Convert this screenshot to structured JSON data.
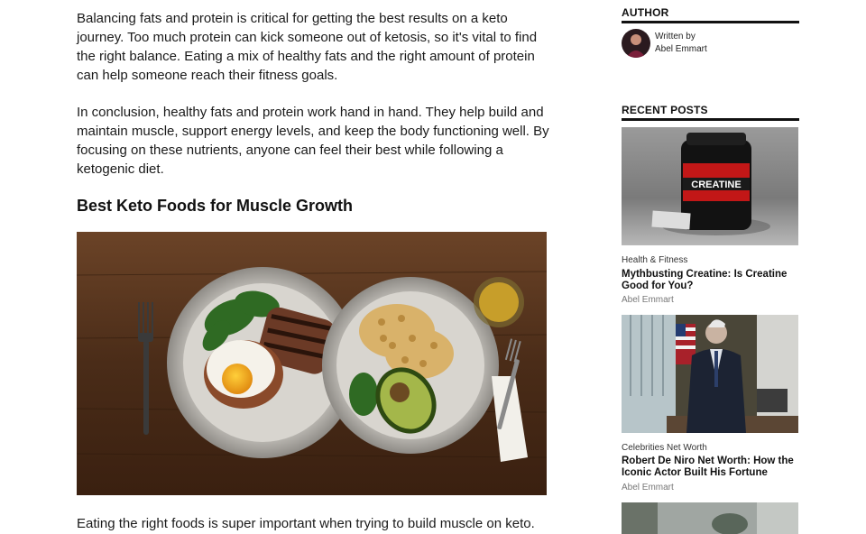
{
  "article": {
    "paragraphs": [
      "Balancing fats and protein is critical for getting the best results on a keto journey. Too much protein can kick someone out of ketosis, so it's vital to find the right balance. Eating a mix of healthy fats and the right amount of protein can help someone reach their fitness goals.",
      "In conclusion, healthy fats and protein work hand in hand. They help build and maintain muscle, support energy levels, and keep the body functioning well. By focusing on these nutrients, anyone can feel their best while following a ketogenic diet.",
      "Eating the right foods is super important when trying to build muscle on keto. The"
    ],
    "section_heading": "Best Keto Foods for Muscle Growth"
  },
  "sidebar": {
    "author_widget": {
      "title": "AUTHOR",
      "written_by": "Written by",
      "author_name": "Abel Emmart"
    },
    "recent_posts": {
      "title": "RECENT POSTS",
      "posts": [
        {
          "category": "Health & Fitness",
          "title": "Mythbusting Creatine: Is Creatine Good for You?",
          "author": "Abel Emmart",
          "thumb_label": "CREATINE"
        },
        {
          "category": "Celebrities Net Worth",
          "title": "Robert De Niro Net Worth: How the Iconic Actor Built His Fortune",
          "author": "Abel Emmart"
        }
      ]
    }
  },
  "colors": {
    "text": "#1a1a1a",
    "muted": "#777777",
    "rule": "#111111",
    "wood": "#5a3a22"
  }
}
